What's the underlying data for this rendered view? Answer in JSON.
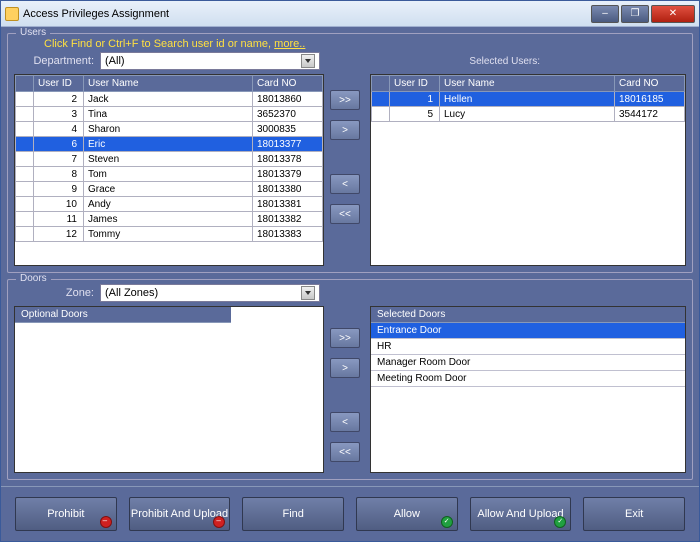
{
  "window": {
    "title": "Access Privileges Assignment"
  },
  "users": {
    "group_title": "Users",
    "hint": "Click Find or Ctrl+F  to Search user id or name,  ",
    "hint_more": "more..",
    "dept_label": "Department:",
    "dept_value": "(All)",
    "selected_label": "Selected Users:",
    "cols": {
      "id": "User ID",
      "name": "User Name",
      "card": "Card NO"
    },
    "rows": [
      {
        "id": "2",
        "name": "Jack",
        "card": "18013860",
        "sel": false
      },
      {
        "id": "3",
        "name": "Tina",
        "card": "3652370",
        "sel": false
      },
      {
        "id": "4",
        "name": "Sharon",
        "card": "3000835",
        "sel": false
      },
      {
        "id": "6",
        "name": "Eric",
        "card": "18013377",
        "sel": true
      },
      {
        "id": "7",
        "name": "Steven",
        "card": "18013378",
        "sel": false
      },
      {
        "id": "8",
        "name": "Tom",
        "card": "18013379",
        "sel": false
      },
      {
        "id": "9",
        "name": "Grace",
        "card": "18013380",
        "sel": false
      },
      {
        "id": "10",
        "name": "Andy",
        "card": "18013381",
        "sel": false
      },
      {
        "id": "11",
        "name": "James",
        "card": "18013382",
        "sel": false
      },
      {
        "id": "12",
        "name": "Tommy",
        "card": "18013383",
        "sel": false
      }
    ],
    "selected_rows": [
      {
        "id": "1",
        "name": "Hellen",
        "card": "18016185",
        "sel": true
      },
      {
        "id": "5",
        "name": "Lucy",
        "card": "3544172",
        "sel": false
      }
    ]
  },
  "doors": {
    "group_title": "Doors",
    "zone_label": "Zone:",
    "zone_value": "(All Zones)",
    "optional_header": "Optional Doors",
    "selected_header": "Selected Doors",
    "optional_items": [],
    "selected_items": [
      {
        "name": "Entrance Door",
        "sel": true
      },
      {
        "name": "HR",
        "sel": false
      },
      {
        "name": "Manager Room  Door",
        "sel": false
      },
      {
        "name": "Meeting Room Door",
        "sel": false
      }
    ]
  },
  "buttons": {
    "add_all": ">>",
    "add": ">",
    "remove": "<",
    "remove_all": "<<",
    "prohibit": "Prohibit",
    "prohibit_upload": "Prohibit And Upload",
    "find": "Find",
    "allow": "Allow",
    "allow_upload": "Allow And Upload",
    "exit": "Exit"
  }
}
